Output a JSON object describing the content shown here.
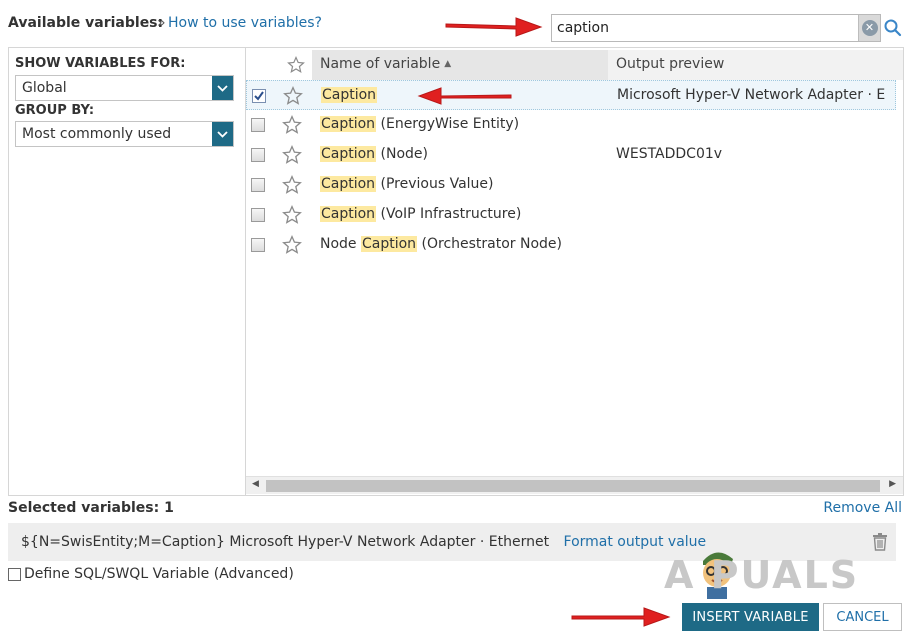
{
  "header": {
    "title": "Available variables:",
    "separator": "»",
    "help_link": "How to use variables?"
  },
  "search": {
    "value": "caption",
    "placeholder": "",
    "clear_icon": "clear-icon",
    "search_icon": "search-icon"
  },
  "filters": {
    "show_label": "SHOW VARIABLES FOR:",
    "show_value": "Global",
    "group_label": "GROUP BY:",
    "group_value": "Most commonly used"
  },
  "grid": {
    "columns": {
      "name": "Name of variable",
      "output": "Output preview"
    },
    "rows": [
      {
        "pre": "",
        "highlight": "Caption",
        "post": "",
        "output": "Microsoft Hyper-V Network Adapter · E",
        "checked": true
      },
      {
        "pre": "",
        "highlight": "Caption",
        "post": " (EnergyWise Entity)",
        "output": "",
        "checked": false
      },
      {
        "pre": "",
        "highlight": "Caption",
        "post": " (Node)",
        "output": "WESTADDC01v",
        "checked": false
      },
      {
        "pre": "",
        "highlight": "Caption",
        "post": " (Previous Value)",
        "output": "",
        "checked": false
      },
      {
        "pre": "",
        "highlight": "Caption",
        "post": " (VoIP Infrastructure)",
        "output": "",
        "checked": false
      },
      {
        "pre": "Node ",
        "highlight": "Caption",
        "post": " (Orchestrator Node)",
        "output": "",
        "checked": false
      }
    ]
  },
  "selected": {
    "title": "Selected variables: 1",
    "remove_all": "Remove All",
    "variable": "${N=SwisEntity;M=Caption}",
    "preview": "Microsoft Hyper-V Network Adapter · Ethernet",
    "format_link": "Format output value"
  },
  "define_label": "Define SQL/SWQL Variable (Advanced)",
  "buttons": {
    "insert": "INSERT VARIABLE",
    "cancel": "CANCEL"
  },
  "watermark": "A  PUALS",
  "colors": {
    "accent": "#1e6a86",
    "link": "#1f6fa8",
    "highlight": "#fde9a0",
    "annotation": "#e02020"
  }
}
